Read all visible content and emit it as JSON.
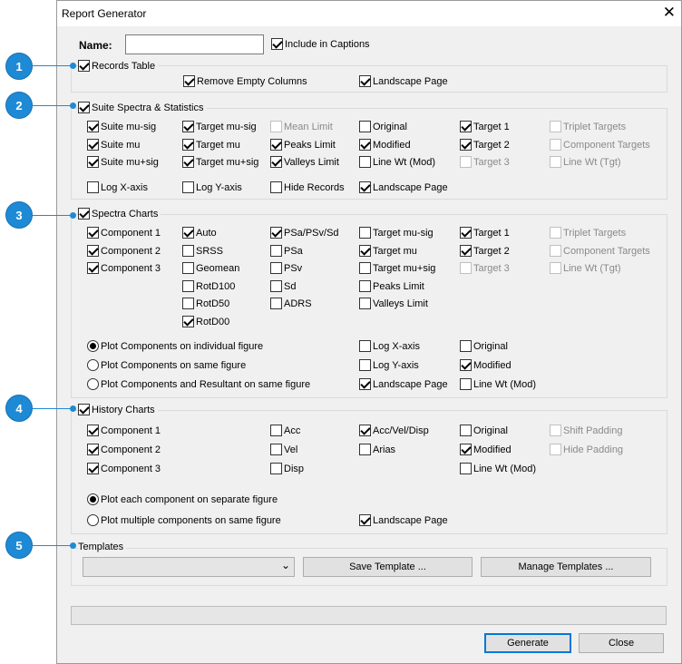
{
  "window": {
    "title": "Report Generator",
    "close_glyph": "✕"
  },
  "name_row": {
    "label": "Name:",
    "value": "",
    "include_captions": "Include in Captions"
  },
  "records": {
    "title": "Records Table",
    "remove_empty": "Remove Empty Columns",
    "landscape": "Landscape Page"
  },
  "suite": {
    "title": "Suite Spectra & Statistics",
    "labels": [
      "Suite mu-sig",
      "Suite mu",
      "Suite mu+sig",
      "Target mu-sig",
      "Target mu",
      "Target mu+sig",
      "Mean Limit",
      "Peaks Limit",
      "Valleys Limit",
      "Original",
      "Modified",
      "Line Wt (Mod)",
      "Target 1",
      "Target 2",
      "Target 3",
      "Triplet Targets",
      "Component Targets",
      "Line Wt (Tgt)",
      "Log X-axis",
      "Log Y-axis",
      "Hide Records",
      "Landscape Page"
    ]
  },
  "spectra": {
    "title": "Spectra Charts",
    "labels": [
      "Component 1",
      "Component 2",
      "Component 3",
      "Auto",
      "SRSS",
      "Geomean",
      "RotD100",
      "RotD50",
      "RotD00",
      "PSa/PSv/Sd",
      "PSa",
      "PSv",
      "Sd",
      "ADRS",
      "Target mu-sig",
      "Target mu",
      "Target mu+sig",
      "Peaks Limit",
      "Valleys Limit",
      "Target 1",
      "Target 2",
      "Target 3",
      "Triplet Targets",
      "Component Targets",
      "Line Wt (Tgt)",
      "Log X-axis",
      "Log Y-axis",
      "Landscape Page",
      "Original",
      "Modified",
      "Line Wt (Mod)"
    ],
    "radios": [
      "Plot Components on individual figure",
      "Plot Components on same figure",
      "Plot Components and Resultant on same figure"
    ]
  },
  "history": {
    "title": "History Charts",
    "labels": [
      "Component 1",
      "Component 2",
      "Component 3",
      "Acc",
      "Vel",
      "Disp",
      "Acc/Vel/Disp",
      "Arias",
      "Original",
      "Modified",
      "Line Wt (Mod)",
      "Shift Padding",
      "Hide Padding",
      "Landscape Page"
    ],
    "radios": [
      "Plot each component on separate figure",
      "Plot multiple components on same figure"
    ]
  },
  "templates": {
    "title": "Templates",
    "select_value": "",
    "save": "Save Template ...",
    "manage": "Manage Templates ..."
  },
  "footer": {
    "generate": "Generate",
    "close": "Close"
  },
  "callouts": [
    "1",
    "2",
    "3",
    "4",
    "5"
  ],
  "colors": {
    "accent": "#1e8ad6",
    "dialog_bg": "#f0f0f0"
  }
}
